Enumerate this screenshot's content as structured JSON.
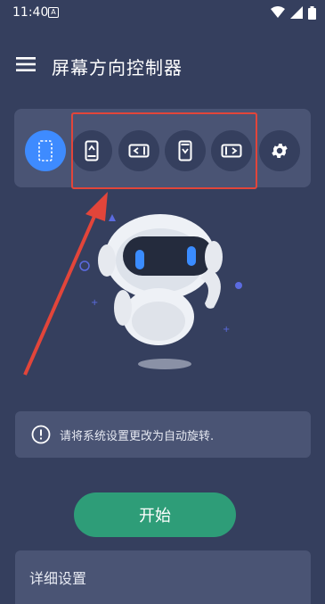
{
  "status_bar": {
    "time": "11:40",
    "notification_glyph": "A",
    "icons": [
      "wifi-icon",
      "signal-icon",
      "battery-icon"
    ]
  },
  "app_bar": {
    "title": "屏幕方向控制器",
    "menu_icon": "menu-icon"
  },
  "orientation_modes": [
    {
      "id": "auto",
      "icon": "auto-rotate-icon",
      "active": true
    },
    {
      "id": "portrait",
      "icon": "portrait-icon",
      "active": false
    },
    {
      "id": "landscape",
      "icon": "landscape-icon",
      "active": false
    },
    {
      "id": "reverse-portrait",
      "icon": "reverse-portrait-icon",
      "active": false
    },
    {
      "id": "reverse-landscape",
      "icon": "reverse-landscape-icon",
      "active": false
    },
    {
      "id": "settings",
      "icon": "gear-icon",
      "active": false
    }
  ],
  "info": {
    "icon": "info-icon",
    "text": "请将系统设置更改为自动旋转."
  },
  "start_button": {
    "label": "开始"
  },
  "details": {
    "title": "详细设置"
  },
  "colors": {
    "background": "#353f5e",
    "card": "#4a5474",
    "accent_blue": "#3e8bff",
    "start_green": "#2e9d78",
    "annotation_red": "#e2453a"
  }
}
